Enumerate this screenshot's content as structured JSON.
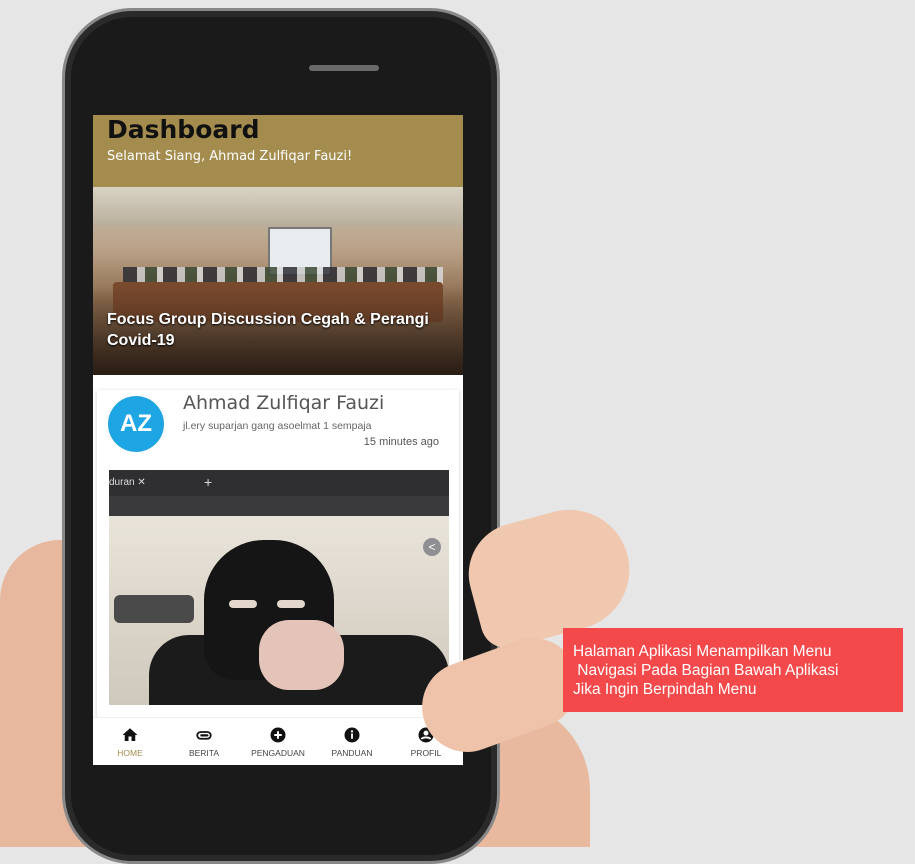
{
  "header": {
    "title": "Dashboard",
    "greeting": "Selamat Siang, Ahmad Zulfiqar Fauzi!"
  },
  "banner": {
    "title": "Focus Group Discussion Cegah & Perangi Covid-19"
  },
  "post": {
    "avatar_initials": "AZ",
    "author": "Ahmad Zulfiqar Fauzi",
    "address": "jl.ery suparjan gang asoelmat 1 sempaja",
    "time": "15 minutes ago",
    "image_tab": "duran"
  },
  "nav": {
    "items": [
      {
        "label": "HOME",
        "icon": "home-icon",
        "active": true
      },
      {
        "label": "BERITA",
        "icon": "paperclip-icon"
      },
      {
        "label": "PENGADUAN",
        "icon": "plus-circle-icon"
      },
      {
        "label": "PANDUAN",
        "icon": "info-circle-icon"
      },
      {
        "label": "PROFIL",
        "icon": "account-circle-icon"
      }
    ]
  },
  "annotation": {
    "text": "Halaman Aplikasi Menampilkan Menu\n Navigasi Pada Bagian Bawah Aplikasi\nJika Ingin Berpindah Menu"
  },
  "colors": {
    "header": "#a38c4e",
    "active_nav": "#a38c4e",
    "avatar": "#1ea6e4",
    "annotation_bg": "#f4494a"
  }
}
